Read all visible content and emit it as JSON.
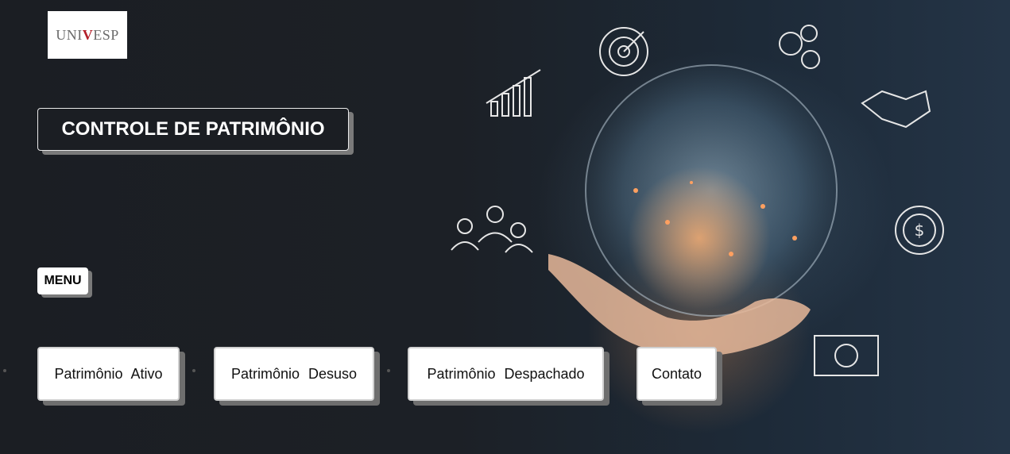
{
  "logo": {
    "text_left": "UNI",
    "text_v": "V",
    "text_right": "ESP"
  },
  "header": {
    "title": "CONTROLE DE PATRIMÔNIO"
  },
  "menu": {
    "label": "MENU",
    "items": [
      {
        "label": "Patrimônio Ativo"
      },
      {
        "label": "Patrimônio Desuso"
      },
      {
        "label": "Patrimônio Despachado"
      },
      {
        "label": "Contato"
      }
    ]
  },
  "colors": {
    "background": "#1b1e23",
    "button_bg": "#ffffff",
    "shadow": "#6e6e6e",
    "logo_accent": "#b3202a"
  },
  "hero_image": {
    "icons": [
      "globe-icon",
      "target-icon",
      "gears-icon",
      "handshake-icon",
      "bar-chart-icon",
      "team-icon",
      "dollar-coin-icon",
      "banknote-icon",
      "hand-icon"
    ]
  }
}
